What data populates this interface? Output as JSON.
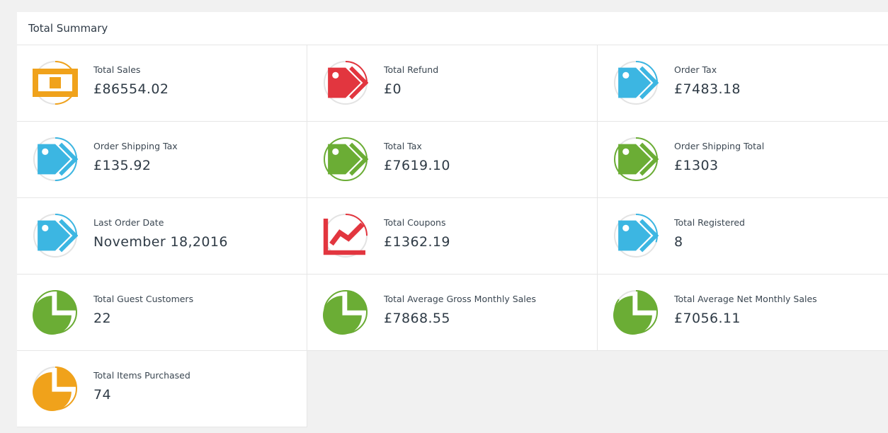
{
  "panel": {
    "title": "Total Summary"
  },
  "colors": {
    "orange": "#f0a21b",
    "red": "#e2363f",
    "blue": "#3cb6e2",
    "green": "#6bad35",
    "track": "#e3e3e3"
  },
  "cards": [
    {
      "label": "Total Sales",
      "value": "£86554.02",
      "icon": "money-bill-icon",
      "color": "orange",
      "progress": 0.5
    },
    {
      "label": "Total Refund",
      "value": "£0",
      "icon": "tag-icon",
      "color": "red",
      "progress": 0.25
    },
    {
      "label": "Order Tax",
      "value": "£7483.18",
      "icon": "tag-icon",
      "color": "blue",
      "progress": 0.25
    },
    {
      "label": "Order Shipping Tax",
      "value": "£135.92",
      "icon": "tag-icon",
      "color": "blue",
      "progress": 0.5
    },
    {
      "label": "Total Tax",
      "value": "£7619.10",
      "icon": "tag-icon",
      "color": "green",
      "progress": 1.0
    },
    {
      "label": "Order Shipping Total",
      "value": "£1303",
      "icon": "tag-icon",
      "color": "green",
      "progress": 0.85
    },
    {
      "label": "Last Order Date",
      "value": "November 18,2016",
      "icon": "tag-icon",
      "color": "blue",
      "progress": 0.25
    },
    {
      "label": "Total Coupons",
      "value": "£1362.19",
      "icon": "line-chart-icon",
      "color": "red",
      "progress": 0.25
    },
    {
      "label": "Total Registered",
      "value": "8",
      "icon": "tag-icon",
      "color": "blue",
      "progress": 0.3
    },
    {
      "label": "Total Guest Customers",
      "value": "22",
      "icon": "pie-chart-icon",
      "color": "green",
      "progress": 1.0
    },
    {
      "label": "Total Average Gross Monthly Sales",
      "value": "£7868.55",
      "icon": "pie-chart-icon",
      "color": "green",
      "progress": 1.0
    },
    {
      "label": "Total Average Net Monthly Sales",
      "value": "£7056.11",
      "icon": "pie-chart-icon",
      "color": "green",
      "progress": 0.85
    },
    {
      "label": "Total Items Purchased",
      "value": "74",
      "icon": "pie-chart-icon",
      "color": "orange",
      "progress": 0.7
    }
  ]
}
